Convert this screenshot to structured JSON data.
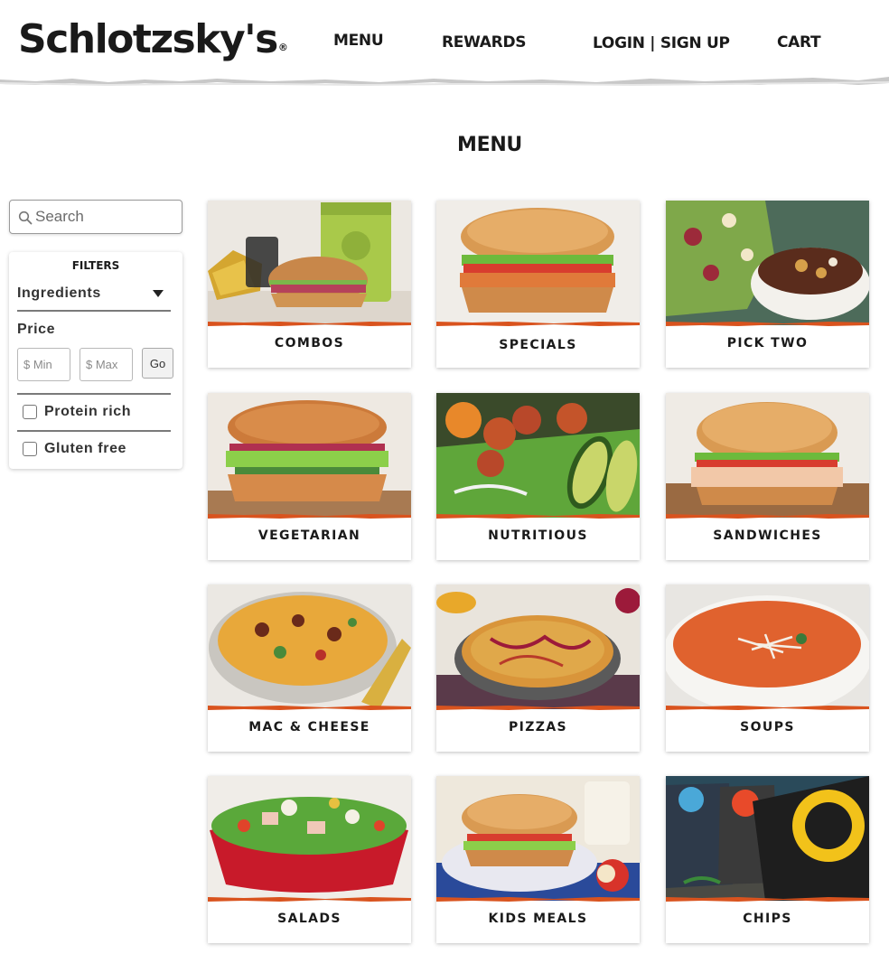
{
  "header": {
    "logo_text": "Schlotzsky's",
    "logo_reg": "®",
    "nav": {
      "menu": "MENU",
      "rewards": "REWARDS",
      "login": "LOGIN | SIGN UP",
      "cart": "CART"
    }
  },
  "page": {
    "title": "MENU"
  },
  "search": {
    "placeholder": "Search",
    "value": "",
    "icon": "search-icon"
  },
  "filters": {
    "title": "FILTERS",
    "ingredients_label": "Ingredients",
    "price_label": "Price",
    "min_placeholder": "$ Min",
    "max_placeholder": "$ Max",
    "go_label": "Go",
    "options": [
      {
        "label": "Protein rich",
        "checked": false
      },
      {
        "label": "Gluten free",
        "checked": false
      }
    ]
  },
  "categories": [
    {
      "name": "COMBOS",
      "image": "sandwich-combo-photo"
    },
    {
      "name": "SPECIALS",
      "image": "sandwich-photo"
    },
    {
      "name": "PICK TWO",
      "image": "salad-soup-photo"
    },
    {
      "name": "VEGETARIAN",
      "image": "vegetarian-sandwich-photo"
    },
    {
      "name": "NUTRITIOUS",
      "image": "shrimp-avocado-photo"
    },
    {
      "name": "SANDWICHES",
      "image": "turkey-sandwich-photo"
    },
    {
      "name": "MAC & CHEESE",
      "image": "mac-cheese-photo"
    },
    {
      "name": "PIZZAS",
      "image": "pizza-photo"
    },
    {
      "name": "SOUPS",
      "image": "tomato-soup-photo"
    },
    {
      "name": "SALADS",
      "image": "salad-bowl-photo"
    },
    {
      "name": "KIDS MEALS",
      "image": "kids-meal-photo"
    },
    {
      "name": "CHIPS",
      "image": "chips-bag-photo"
    }
  ],
  "colors": {
    "accent": "#d9531e",
    "text": "#1a1a1a"
  }
}
